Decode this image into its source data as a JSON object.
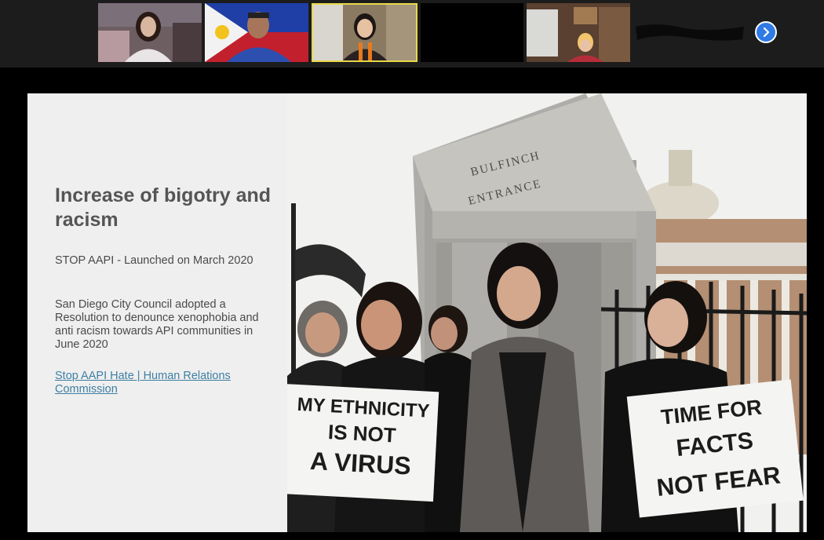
{
  "gallery": {
    "participants": [
      {
        "id": "p1",
        "active": false
      },
      {
        "id": "p2",
        "active": false
      },
      {
        "id": "p3",
        "active": true
      },
      {
        "id": "p4",
        "active": false
      },
      {
        "id": "p5",
        "active": false
      }
    ],
    "next_icon": "chevron-right-icon"
  },
  "slide": {
    "title": "Increase of bigotry and racism",
    "paragraphs": [
      "STOP AAPI - Launched on March 2020",
      "San Diego City Council adopted a Resolution to denounce xenophobia and anti racism towards API communities in June 2020"
    ],
    "link_text": "Stop AAPI Hate | Human Relations Commission",
    "photo": {
      "engraving_line1": "BULFINCH",
      "engraving_line2": "ENTRANCE",
      "sign_left": [
        "MY ETHNICITY",
        "IS NOT",
        "A VIRUS"
      ],
      "sign_right": [
        "TIME FOR",
        "FACTS",
        "NOT FEAR"
      ]
    }
  },
  "colors": {
    "accent_active": "#e8d84a",
    "next_button": "#2f7ae5",
    "link": "#3e7fa3",
    "title_text": "#555555"
  }
}
